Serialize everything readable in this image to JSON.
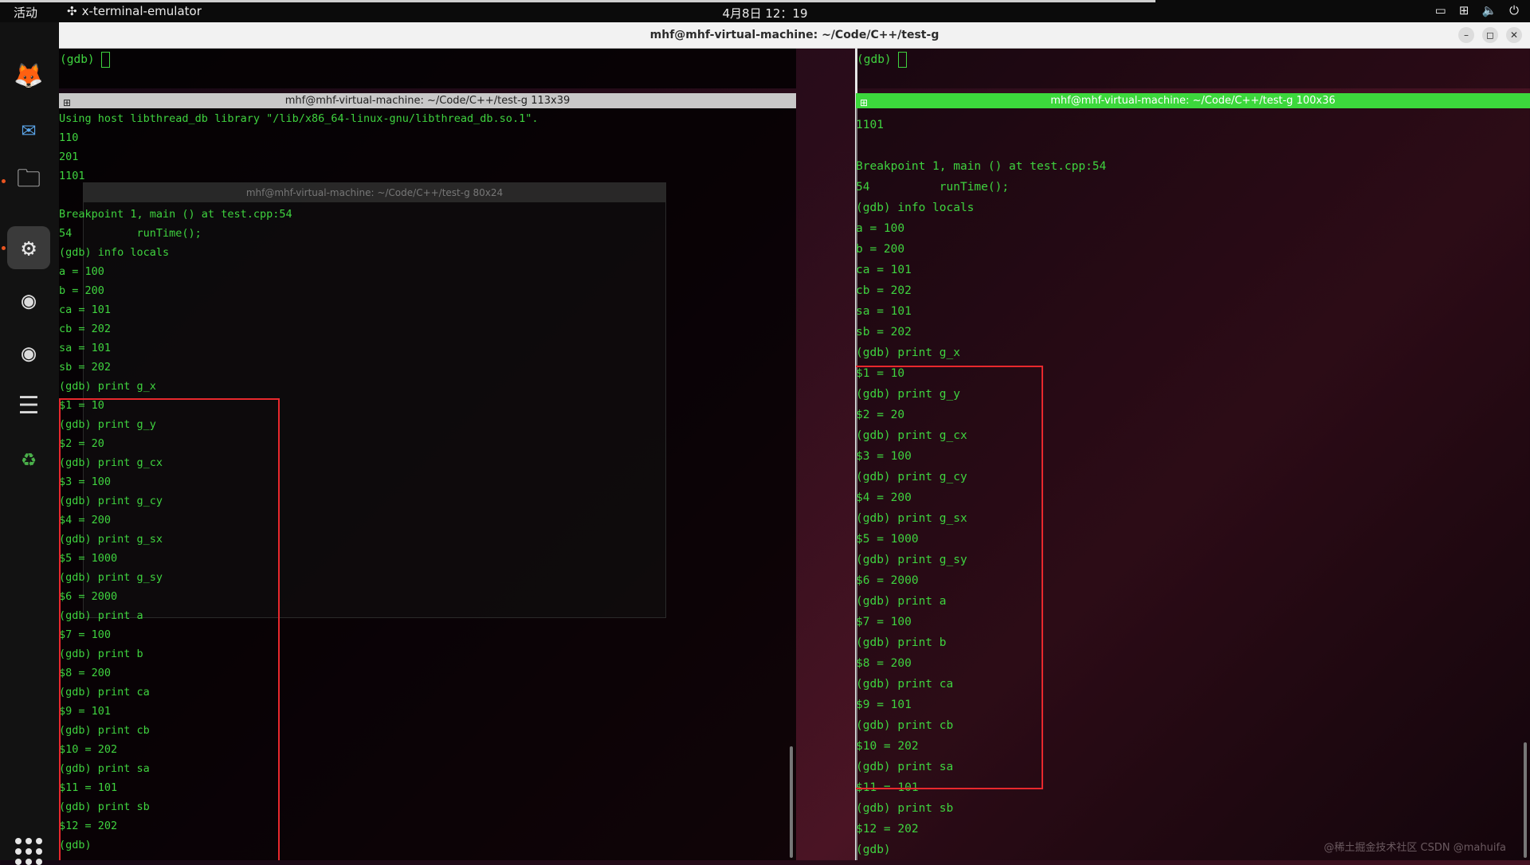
{
  "topbar": {
    "activities": "活动",
    "app_name": "x-terminal-emulator",
    "clock": "4月8日 12：19",
    "progress_fraction": 0.755
  },
  "dock": {
    "items": [
      {
        "name": "firefox-icon",
        "glyph": "🦊"
      },
      {
        "name": "thunderbird-icon",
        "glyph": "✉"
      },
      {
        "name": "files-icon",
        "glyph": "🗀"
      },
      {
        "name": "settings-icon",
        "glyph": "⚙"
      },
      {
        "name": "disc-icon",
        "glyph": "◉"
      },
      {
        "name": "disc-icon-2",
        "glyph": "◉"
      },
      {
        "name": "text-editor-icon",
        "glyph": "☰"
      },
      {
        "name": "trash-icon",
        "glyph": "♻"
      }
    ]
  },
  "window": {
    "title": "mhf@mhf-virtual-machine: ~/Code/C++/test-g"
  },
  "panes": {
    "top_left": {
      "prompt": "(gdb)"
    },
    "top_right": {
      "prompt": "(gdb)"
    },
    "left": {
      "title": "mhf@mhf-virtual-machine: ~/Code/C++/test-g 113x39",
      "lines": [
        "Using host libthread_db library \"/lib/x86_64-linux-gnu/libthread_db.so.1\".",
        "110",
        "201",
        "1101",
        "",
        "Breakpoint 1, main () at test.cpp:54",
        "54          runTime();",
        "(gdb) info locals",
        "a = 100",
        "b = 200",
        "ca = 101",
        "cb = 202",
        "sa = 101",
        "sb = 202",
        "(gdb) print g_x",
        "$1 = 10",
        "(gdb) print g_y",
        "$2 = 20",
        "(gdb) print g_cx",
        "$3 = 100",
        "(gdb) print g_cy",
        "$4 = 200",
        "(gdb) print g_sx",
        "$5 = 1000",
        "(gdb) print g_sy",
        "$6 = 2000",
        "(gdb) print a",
        "$7 = 100",
        "(gdb) print b",
        "$8 = 200",
        "(gdb) print ca",
        "$9 = 101",
        "(gdb) print cb",
        "$10 = 202",
        "(gdb) print sa",
        "$11 = 101",
        "(gdb) print sb",
        "$12 = 202",
        "(gdb)"
      ]
    },
    "right": {
      "title": "mhf@mhf-virtual-machine: ~/Code/C++/test-g 100x36",
      "lines": [
        "1101",
        "",
        "Breakpoint 1, main () at test.cpp:54",
        "54          runTime();",
        "(gdb) info locals",
        "a = 100",
        "b = 200",
        "ca = 101",
        "cb = 202",
        "sa = 101",
        "sb = 202",
        "(gdb) print g_x",
        "$1 = 10",
        "(gdb) print g_y",
        "$2 = 20",
        "(gdb) print g_cx",
        "$3 = 100",
        "(gdb) print g_cy",
        "$4 = 200",
        "(gdb) print g_sx",
        "$5 = 1000",
        "(gdb) print g_sy",
        "$6 = 2000",
        "(gdb) print a",
        "$7 = 100",
        "(gdb) print b",
        "$8 = 200",
        "(gdb) print ca",
        "$9 = 101",
        "(gdb) print cb",
        "$10 = 202",
        "(gdb) print sa",
        "$11 = 101",
        "(gdb) print sb",
        "$12 = 202",
        "(gdb)"
      ]
    },
    "ghost_window_title": "mhf@mhf-virtual-machine: ~/Code/C++/test-g 80x24"
  },
  "watermark": "@稀土掘金技术社区   CSDN @mahuifa",
  "colors": {
    "terminal_green": "#3fd33f",
    "highlight_red": "#e8282d",
    "active_title_green": "#3cd83c"
  }
}
